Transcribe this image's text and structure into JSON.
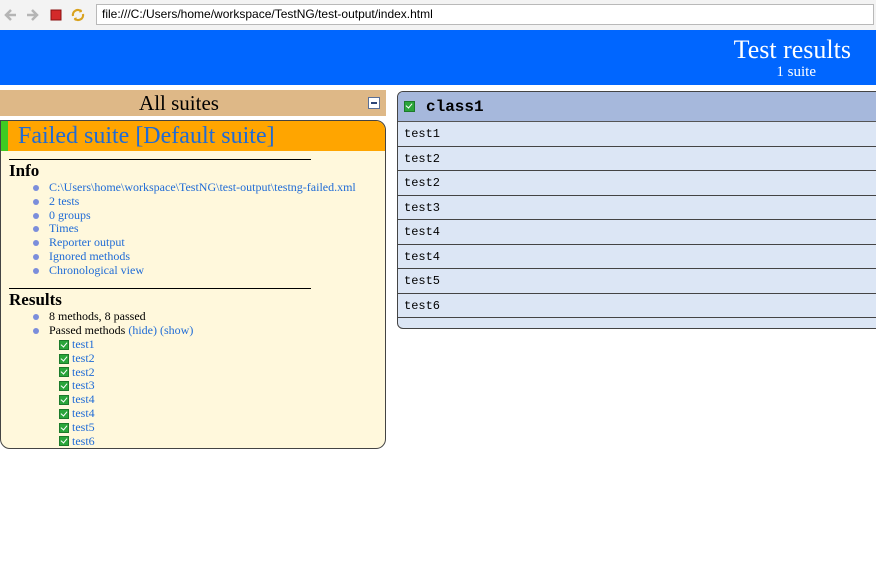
{
  "browser": {
    "url": "file:///C:/Users/home/workspace/TestNG/test-output/index.html"
  },
  "header": {
    "title": "Test results",
    "subtitle": "1 suite"
  },
  "left": {
    "all_suites_label": "All suites",
    "suite_title": "Failed suite [Default suite]",
    "info": {
      "title": "Info",
      "items": [
        "C:\\Users\\home\\workspace\\TestNG\\test-output\\testng-failed.xml",
        "2 tests",
        "0 groups",
        "Times",
        "Reporter output",
        "Ignored methods",
        "Chronological view"
      ]
    },
    "results": {
      "title": "Results",
      "summary": "8 methods, 8 passed",
      "passed_label": "Passed methods",
      "hide_label": "(hide)",
      "show_label": "(show)",
      "methods": [
        "test1",
        "test2",
        "test2",
        "test3",
        "test4",
        "test4",
        "test5",
        "test6"
      ]
    }
  },
  "right": {
    "class_name": "class1",
    "rows": [
      "test1",
      "test2",
      "test2",
      "test3",
      "test4",
      "test4",
      "test5",
      "test6"
    ]
  },
  "colors": {
    "header_bg": "#0066ff",
    "suite_header_bg": "#ffa500",
    "all_suites_bg": "#deb887",
    "panel_bg": "#fff8dc",
    "link": "#1f6bd6",
    "class_header_bg": "#a6b8dc",
    "class_rows_bg": "#dce6f5",
    "pass_green": "#2aa53a"
  }
}
